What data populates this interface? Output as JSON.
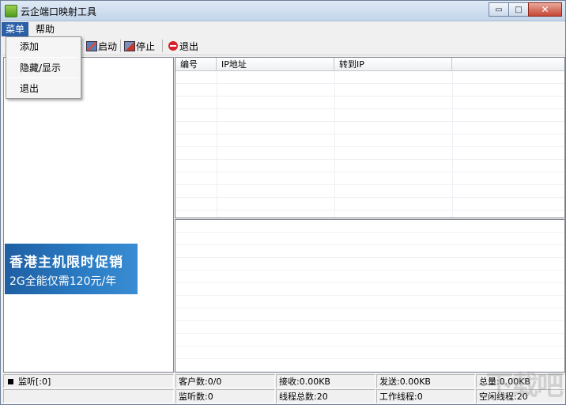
{
  "window": {
    "title": "云企端口映射工具",
    "controls": {
      "minimize": "▭",
      "maximize": "□",
      "close": "✕"
    }
  },
  "menubar": {
    "items": [
      {
        "label": "菜单",
        "active": true
      },
      {
        "label": "帮助",
        "active": false
      }
    ]
  },
  "menu_dropdown": {
    "items": [
      "添加",
      "隐藏/显示",
      "退出"
    ]
  },
  "toolbar": {
    "start_label": "启动",
    "stop_label": "停止",
    "exit_label": "退出",
    "icons": {
      "start": "start-icon",
      "stop": "stop-icon",
      "exit": "exit-icon"
    }
  },
  "ad_banner": {
    "line1": "香港主机限时促销",
    "line2": "2G全能仅需120元/年"
  },
  "grid": {
    "columns": [
      "编号",
      "IP地址",
      "转到IP",
      ""
    ],
    "rows": []
  },
  "statusbar": {
    "listen": "监听[:0]",
    "clients": "客户数:0/0",
    "listeners": "监听数:0",
    "receive": "接收:0.00KB",
    "threads_total": "线程总数:20",
    "send": "发送:0.00KB",
    "threads_working": "工作线程:0",
    "total": "总量:0.00KB",
    "threads_idle": "空闲线程:20"
  },
  "watermark": "下载吧",
  "colors": {
    "menu_active": "#2b5fa6",
    "banner": "#2a7cc4",
    "exit_red": "#d8222a"
  }
}
